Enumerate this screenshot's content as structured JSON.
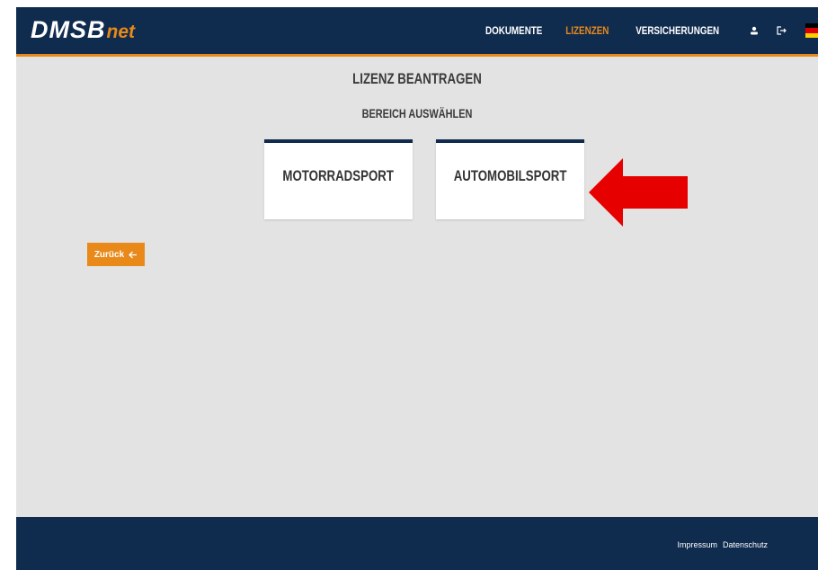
{
  "header": {
    "logo_main": "DMSB",
    "logo_sub": "net",
    "nav": [
      "DOKUMENTE",
      "LIZENZEN",
      "VERSICHERUNGEN"
    ],
    "active_nav": "LIZENZEN",
    "icons": [
      "user-icon",
      "logout-icon",
      "german-flag-icon"
    ],
    "colors": {
      "brand_navy": "#0f2b4e",
      "accent_orange": "#e8891a"
    }
  },
  "main": {
    "title": "LIZENZ BEANTRAGEN",
    "subtitle": "BEREICH AUSWÄHLEN",
    "cards": [
      {
        "label": "MOTORRADSPORT"
      },
      {
        "label": "AUTOMOBILSPORT"
      }
    ],
    "back_label": "Zurück",
    "back_icon": "arrow-left-icon",
    "annotation": "red-arrow-icon"
  },
  "footer": {
    "links": [
      "Impressum",
      "Datenschutz"
    ]
  }
}
